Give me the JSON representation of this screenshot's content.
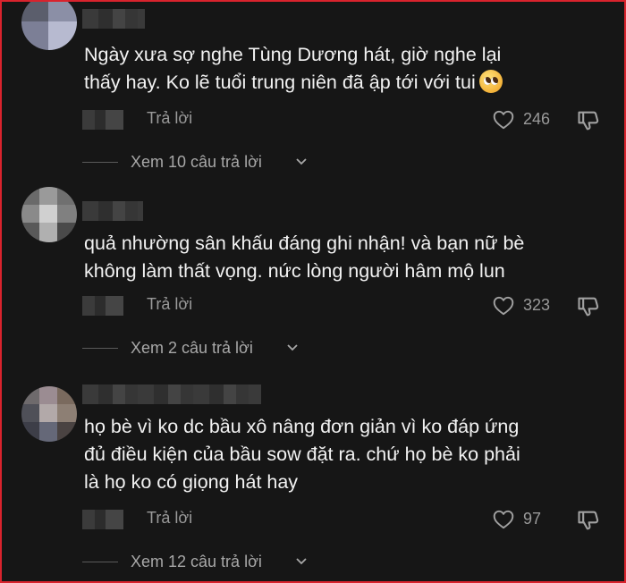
{
  "comments": [
    {
      "text_lines": [
        "Ngày xưa sợ nghe Tùng Dương hát, giờ nghe lại",
        "thấy hay. Ko lẽ tuổi trung niên đã ập tới với tui"
      ],
      "emoji": "pleading-face",
      "reply_label": "Trả lời",
      "likes": "246",
      "view_replies": "Xem 10 câu trả lời"
    },
    {
      "text_lines": [
        "quả nhường sân khấu đáng ghi nhận! và bạn nữ bè",
        "không làm thất vọng. nức lòng người hâm mộ lun"
      ],
      "reply_label": "Trả lời",
      "likes": "323",
      "view_replies": "Xem 2 câu trả lời"
    },
    {
      "text_lines": [
        "họ bè vì ko dc bầu xô nâng đơn giản vì ko đáp ứng",
        "đủ điều kiện của bầu sow đặt ra. chứ họ bè ko phải",
        "là họ ko có giọng hát hay"
      ],
      "reply_label": "Trả lời",
      "likes": "97",
      "view_replies": "Xem 12 câu trả lời"
    }
  ],
  "icons": {
    "like": "heart-icon",
    "dislike": "thumbs-down-icon",
    "expand": "chevron-down-icon"
  },
  "colors": {
    "background": "#161616",
    "text": "#f2f2f2",
    "muted": "#9a9a9a",
    "frame_border": "#d9232d"
  }
}
